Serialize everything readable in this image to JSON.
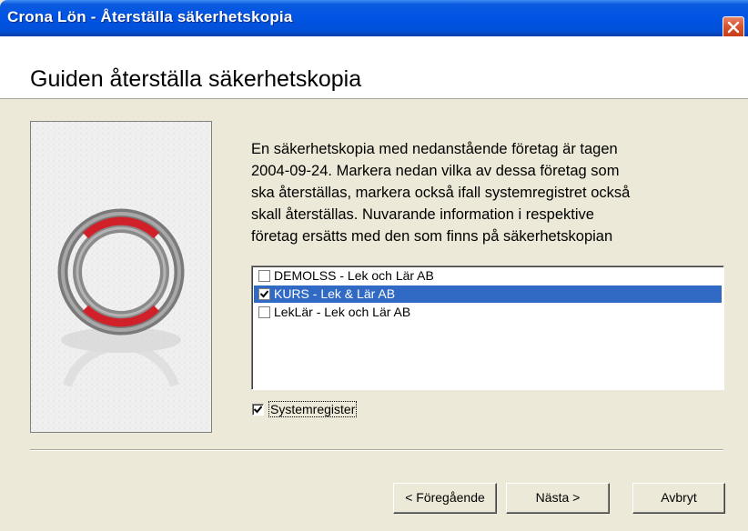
{
  "window": {
    "title": "Crona Lön - Återställa säkerhetskopia"
  },
  "header": {
    "title": "Guiden återställa säkerhetskopia"
  },
  "description": {
    "text": "En säkerhetskopia med nedanstående företag är tagen\n2004-09-24. Markera nedan vilka av dessa företag som\nska återställas, markera också ifall systemregistret också\nskall återställas. Nuvarande information i respektive\nföretag ersätts med den som finns på säkerhetskopian"
  },
  "companies": [
    {
      "label": "DEMOLSS - Lek och Lär AB",
      "checked": false,
      "selected": false
    },
    {
      "label": "KURS - Lek & Lär AB",
      "checked": true,
      "selected": true
    },
    {
      "label": "LekLär - Lek och Lär AB",
      "checked": false,
      "selected": false
    }
  ],
  "systemregister": {
    "label": "Systemregister",
    "checked": true
  },
  "buttons": {
    "prev_label": "< Föregående",
    "next_label": "Nästa >",
    "cancel_label": "Avbryt"
  },
  "colors": {
    "titlebar": "#0054e3",
    "selection": "#316ac5",
    "ring_red": "#d0202a",
    "close_button": "#d8542e"
  },
  "icons": {
    "close": "close-icon",
    "wizard_image": "lifebuoy-image",
    "checkmark": "checkmark-icon"
  }
}
